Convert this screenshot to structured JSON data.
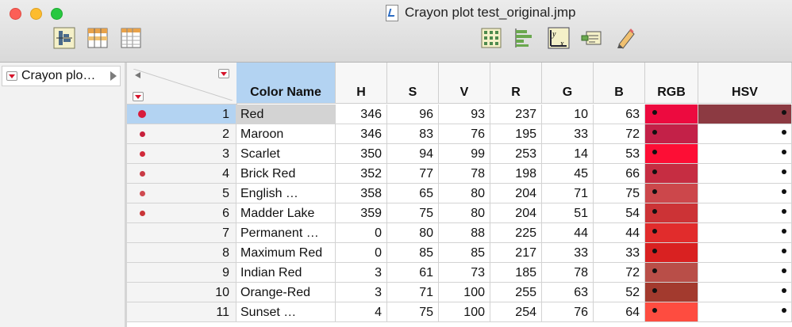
{
  "window": {
    "title": "Crayon plot test_original.jmp"
  },
  "toolbar": {
    "left_icons": [
      "distribution-icon",
      "tabulate-icon",
      "data-table-icon"
    ],
    "right_icons": [
      "table-grid-icon",
      "bar-chart-icon",
      "fit-y-by-x-icon",
      "script-icon",
      "pencil-icon"
    ]
  },
  "left_pane": {
    "item_label": "Crayon plo…"
  },
  "columns": [
    {
      "key": "name",
      "label": "Color Name"
    },
    {
      "key": "h",
      "label": "H"
    },
    {
      "key": "s",
      "label": "S"
    },
    {
      "key": "v",
      "label": "V"
    },
    {
      "key": "r",
      "label": "R"
    },
    {
      "key": "g",
      "label": "G"
    },
    {
      "key": "b",
      "label": "B"
    },
    {
      "key": "rgb",
      "label": "RGB"
    },
    {
      "key": "hsv",
      "label": "HSV"
    }
  ],
  "rows": [
    {
      "n": "1",
      "name": "Red",
      "h": "346",
      "s": "96",
      "v": "93",
      "r": "237",
      "g": "10",
      "b": "63",
      "rgb_color": "#ed0a3f",
      "hsv_color": "#8c3a42",
      "marker_color": "#d81b3b"
    },
    {
      "n": "2",
      "name": "Maroon",
      "h": "346",
      "s": "83",
      "v": "76",
      "r": "195",
      "g": "33",
      "b": "72",
      "rgb_color": "#c32148",
      "hsv_color": "#ffffff",
      "marker_color": "#c7203c"
    },
    {
      "n": "3",
      "name": "Scarlet",
      "h": "350",
      "s": "94",
      "v": "99",
      "r": "253",
      "g": "14",
      "b": "53",
      "rgb_color": "#fd0e35",
      "hsv_color": "#ffffff",
      "marker_color": "#d12a3a"
    },
    {
      "n": "4",
      "name": "Brick Red",
      "h": "352",
      "s": "77",
      "v": "78",
      "r": "198",
      "g": "45",
      "b": "66",
      "rgb_color": "#c62d42",
      "hsv_color": "#ffffff",
      "marker_color": "#c93a45"
    },
    {
      "n": "5",
      "name": "English …",
      "h": "358",
      "s": "65",
      "v": "80",
      "r": "204",
      "g": "71",
      "b": "75",
      "rgb_color": "#cc474b",
      "hsv_color": "#ffffff",
      "marker_color": "#cf4a50"
    },
    {
      "n": "6",
      "name": "Madder Lake",
      "h": "359",
      "s": "75",
      "v": "80",
      "r": "204",
      "g": "51",
      "b": "54",
      "rgb_color": "#cc3336",
      "hsv_color": "#ffffff",
      "marker_color": "#c93538"
    },
    {
      "n": "7",
      "name": "Permanent …",
      "h": "0",
      "s": "80",
      "v": "88",
      "r": "225",
      "g": "44",
      "b": "44",
      "rgb_color": "#e12c2c",
      "hsv_color": "#ffffff",
      "marker_color": ""
    },
    {
      "n": "8",
      "name": "Maximum Red",
      "h": "0",
      "s": "85",
      "v": "85",
      "r": "217",
      "g": "33",
      "b": "33",
      "rgb_color": "#d92121",
      "hsv_color": "#ffffff",
      "marker_color": ""
    },
    {
      "n": "9",
      "name": "Indian Red",
      "h": "3",
      "s": "61",
      "v": "73",
      "r": "185",
      "g": "78",
      "b": "72",
      "rgb_color": "#b94e48",
      "hsv_color": "#ffffff",
      "marker_color": ""
    },
    {
      "n": "10",
      "name": "Orange-Red",
      "h": "3",
      "s": "71",
      "v": "100",
      "r": "255",
      "g": "63",
      "b": "52",
      "rgb_color": "#a33a2e",
      "hsv_color": "#ffffff",
      "marker_color": ""
    },
    {
      "n": "11",
      "name": "Sunset …",
      "h": "4",
      "s": "75",
      "v": "100",
      "r": "254",
      "g": "76",
      "b": "64",
      "rgb_color": "#fe4c40",
      "hsv_color": "#ffffff",
      "marker_color": ""
    }
  ],
  "selected_row": 0
}
